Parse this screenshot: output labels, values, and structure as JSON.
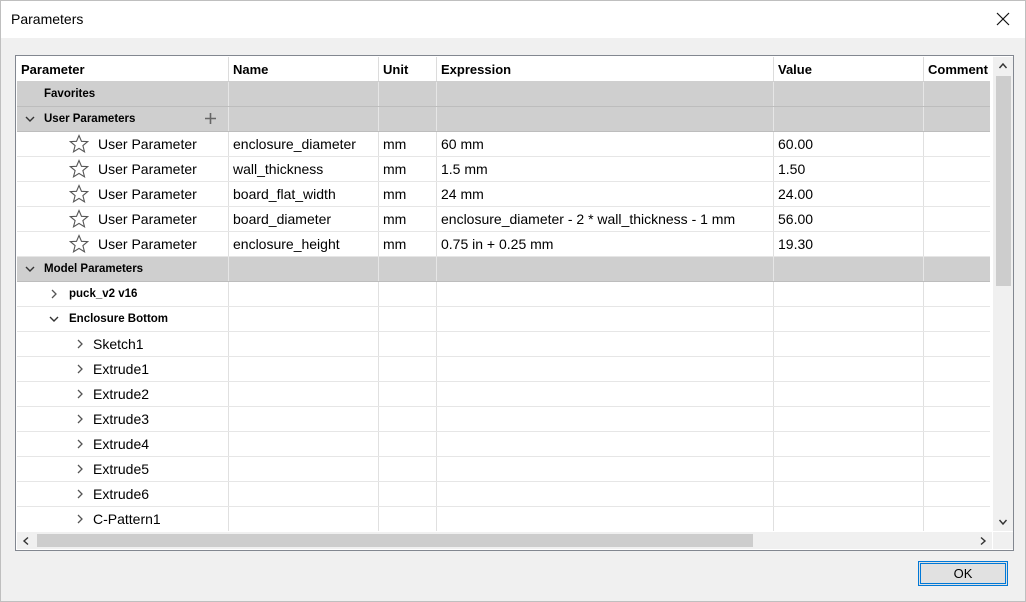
{
  "window": {
    "title": "Parameters",
    "ok_label": "OK"
  },
  "columns": [
    "Parameter",
    "Name",
    "Unit",
    "Expression",
    "Value",
    "Comment"
  ],
  "groups": {
    "favorites": "Favorites",
    "user_parameters": "User Parameters",
    "model_parameters": "Model Parameters"
  },
  "user_parameters": [
    {
      "type": "User Parameter",
      "name": "enclosure_diameter",
      "unit": "mm",
      "expression": "60 mm",
      "value": "60.00"
    },
    {
      "type": "User Parameter",
      "name": "wall_thickness",
      "unit": "mm",
      "expression": "1.5 mm",
      "value": "1.50"
    },
    {
      "type": "User Parameter",
      "name": "board_flat_width",
      "unit": "mm",
      "expression": "24 mm",
      "value": "24.00"
    },
    {
      "type": "User Parameter",
      "name": "board_diameter",
      "unit": "mm",
      "expression": "enclosure_diameter - 2 * wall_thickness - 1 mm",
      "value": "56.00"
    },
    {
      "type": "User Parameter",
      "name": "enclosure_height",
      "unit": "mm",
      "expression": "0.75 in + 0.25 mm",
      "value": "19.30"
    }
  ],
  "model_tree": {
    "component": "puck_v2 v16",
    "body": "Enclosure Bottom",
    "features": [
      "Sketch1",
      "Extrude1",
      "Extrude2",
      "Extrude3",
      "Extrude4",
      "Extrude5",
      "Extrude6",
      "C-Pattern1"
    ]
  },
  "icons": {
    "close": "close-icon",
    "favorite": "star-outline-icon",
    "add": "plus-icon",
    "expand": "chevron-right-icon",
    "collapse": "chevron-down-icon"
  },
  "colors": {
    "group_row_bg": "#cfcfcf",
    "ok_border": "#0078d7",
    "scroll_thumb": "#cdcdcd"
  }
}
